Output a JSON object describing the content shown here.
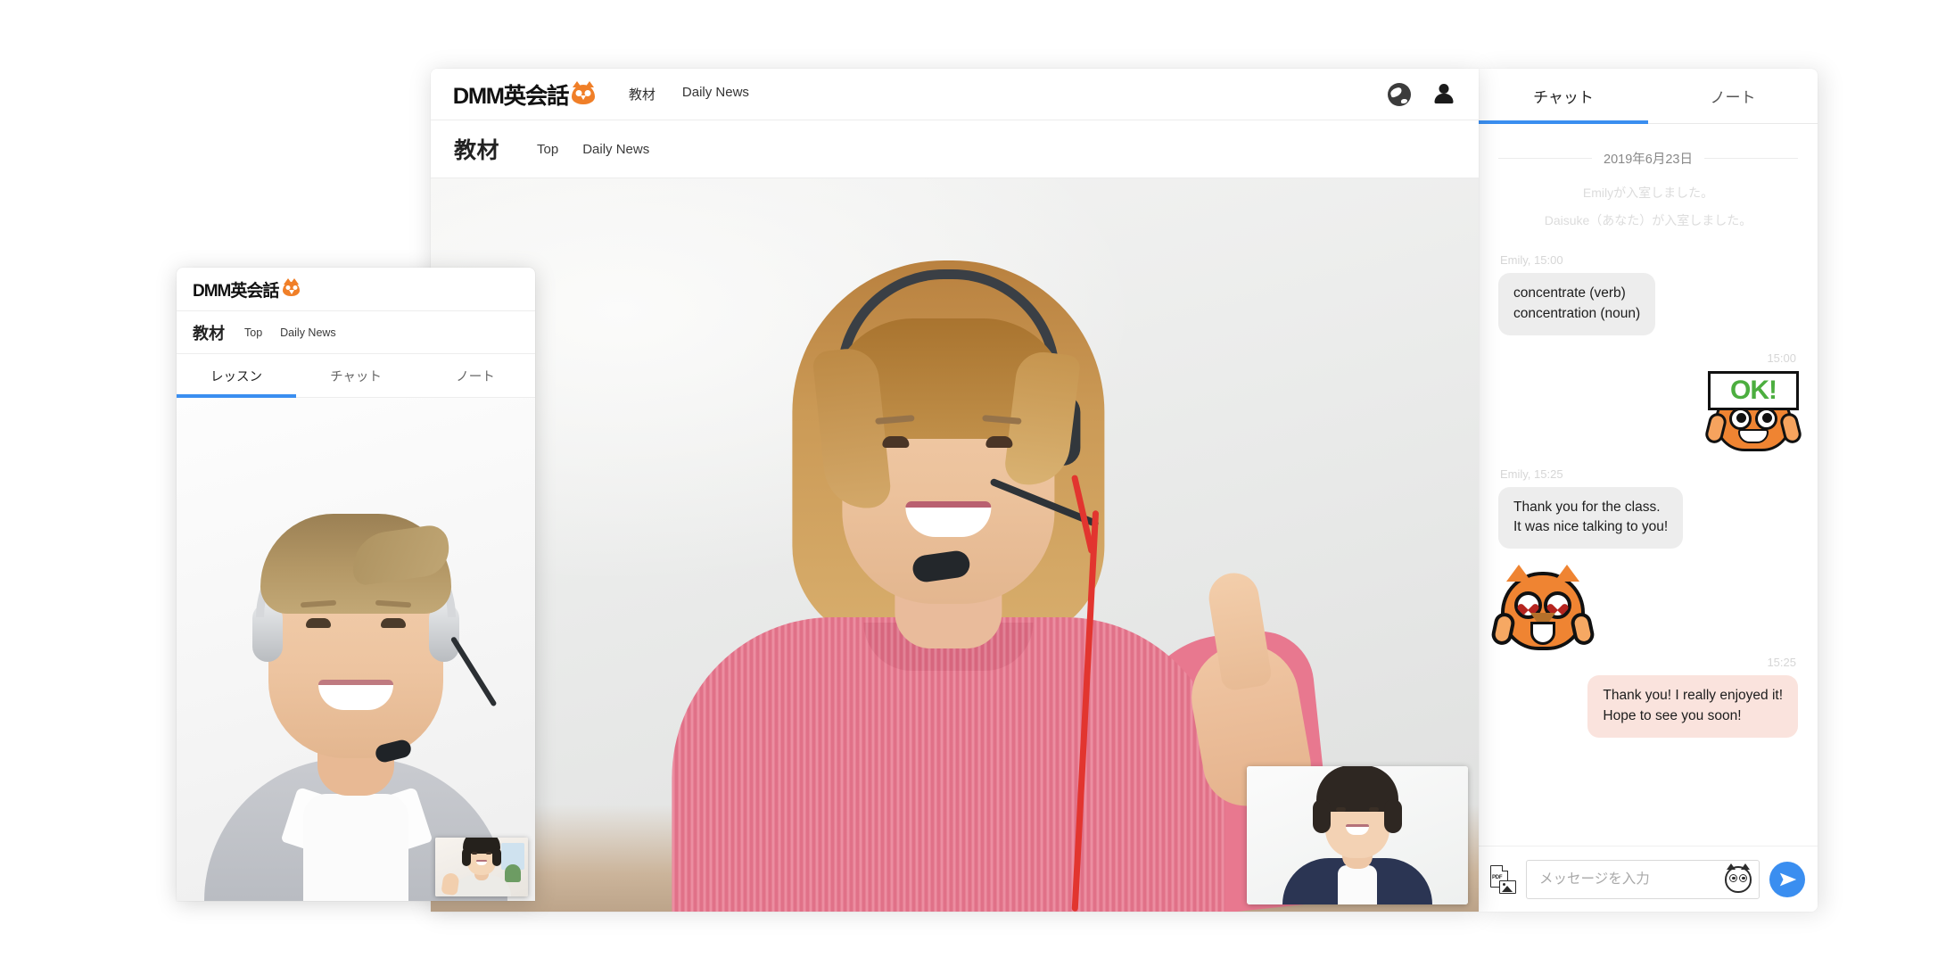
{
  "desktop_window": {
    "brand": {
      "text": "DMM英会話",
      "icon": "owl-logo-icon"
    },
    "nav_links": [
      {
        "label": "教材"
      },
      {
        "label": "Daily News"
      }
    ],
    "header_icons": [
      {
        "name": "globe-icon"
      },
      {
        "name": "user-icon"
      }
    ],
    "sub_header": {
      "heading": "教材",
      "breadcrumbs": [
        {
          "label": "Top"
        },
        {
          "label": "Daily News"
        }
      ]
    },
    "video": {
      "main_participant": "Emily",
      "pip_participant": "Daisuke"
    }
  },
  "chat_panel": {
    "tabs": [
      {
        "label": "チャット",
        "active": true
      },
      {
        "label": "ノート",
        "active": false
      }
    ],
    "date_separator": "2019年6月23日",
    "system_messages": [
      "Emilyが入室しました。",
      "Daisuke（あなた）が入室しました。"
    ],
    "messages": [
      {
        "type": "text",
        "side": "them",
        "meta": "Emily, 15:00",
        "lines": [
          "concentrate (verb)",
          "concentration (noun)"
        ]
      },
      {
        "type": "sticker",
        "side": "me",
        "meta": "15:00",
        "sticker": "owl-ok-sticker",
        "sticker_text": "OK!"
      },
      {
        "type": "text",
        "side": "them",
        "meta": "Emily, 15:25",
        "lines": [
          "Thank you for the class.",
          "It was nice talking to you!"
        ]
      },
      {
        "type": "sticker",
        "side": "them",
        "meta": "",
        "sticker": "owl-heart-eyes-sticker"
      },
      {
        "type": "text",
        "side": "me",
        "meta": "15:25",
        "lines": [
          "Thank you! I really enjoyed it!",
          "Hope to see you soon!"
        ]
      }
    ],
    "composer": {
      "attach_icon": "pdf-image-attach-icon",
      "placeholder": "メッセージを入力",
      "value": "",
      "sticker_icon": "owl-sticker-icon",
      "send_icon": "send-paper-plane-icon"
    }
  },
  "mobile_window": {
    "brand": {
      "text": "DMM英会話",
      "icon": "owl-logo-icon"
    },
    "sub_header": {
      "heading": "教材",
      "breadcrumbs": [
        {
          "label": "Top"
        },
        {
          "label": "Daily News"
        }
      ]
    },
    "tabs": [
      {
        "label": "レッスン",
        "active": true
      },
      {
        "label": "チャット",
        "active": false
      },
      {
        "label": "ノート",
        "active": false
      }
    ],
    "video": {
      "main_participant": "teacher",
      "pip_participant": "student"
    }
  },
  "colors": {
    "accent_blue": "#3a8ef0",
    "brand_orange": "#ef8432",
    "bubble_them": "#ededed",
    "bubble_me": "#fae3dd",
    "sticker_green": "#4cae3f",
    "page_background": "#ffffff"
  }
}
